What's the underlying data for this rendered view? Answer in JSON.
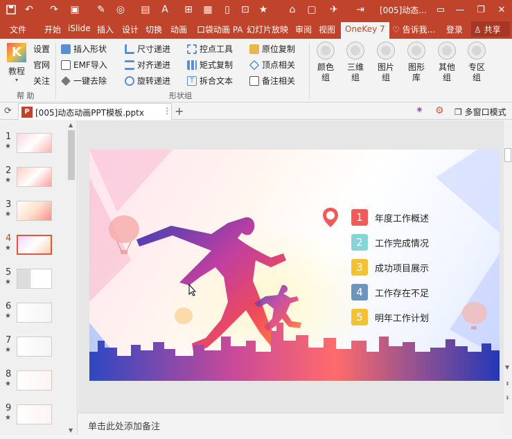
{
  "titlebar": {
    "doc_title": "[005]动态...",
    "icons": [
      "save-icon",
      "undo-icon",
      "redo-icon",
      "slideshow-icon",
      "format-painter-icon",
      "color-icon",
      "text-box-icon",
      "format-icon",
      "screenshot-icon",
      "image-icon",
      "document-icon",
      "star-icon",
      "bookmark-icon",
      "more-icon"
    ],
    "restore_glyph": "▭"
  },
  "tabs": {
    "file": "文件",
    "items": [
      "开始",
      "iSlide",
      "插入",
      "设计",
      "切换",
      "动画",
      "口袋动画 PA",
      "幻灯片放映",
      "审阅",
      "视图"
    ],
    "active": "OneKey 7",
    "tell_me": "告诉我...",
    "login": "登录",
    "share": "共享"
  },
  "ribbon": {
    "tutorial": "教程",
    "help_items": [
      "设置",
      "官网",
      "关注"
    ],
    "help_group": "帮 助",
    "shape_group": "形状组",
    "col1": [
      "插入形状",
      "EMF导入",
      "一键去除"
    ],
    "col2": [
      "尺寸递进",
      "对齐递进",
      "旋转递进"
    ],
    "col3": [
      "控点工具",
      "矩式复制",
      "拆合文本"
    ],
    "col4": [
      "原位复制",
      "顶点相关",
      "备注相关"
    ],
    "big_buttons": [
      {
        "l1": "颜色",
        "l2": "组"
      },
      {
        "l1": "三维",
        "l2": "组"
      },
      {
        "l1": "图片",
        "l2": "组"
      },
      {
        "l1": "图形",
        "l2": "库"
      },
      {
        "l1": "其他",
        "l2": "组"
      },
      {
        "l1": "专区",
        "l2": "组"
      }
    ]
  },
  "document": {
    "tab_name": "[005]动态动画PPT模板.pptx",
    "multi_window": "多窗口模式"
  },
  "thumbnails": {
    "numbers": [
      "1",
      "2",
      "3",
      "4",
      "5",
      "6",
      "7",
      "8",
      "9"
    ],
    "selected": "4",
    "star": "★"
  },
  "slide": {
    "toc": [
      {
        "num": "1",
        "text": "年度工作概述",
        "color": "#ef5b5b"
      },
      {
        "num": "2",
        "text": "工作完成情况",
        "color": "#86d3d8"
      },
      {
        "num": "3",
        "text": "成功项目展示",
        "color": "#f2c234"
      },
      {
        "num": "4",
        "text": "工作存在不足",
        "color": "#6b95bf"
      },
      {
        "num": "5",
        "text": "明年工作计划",
        "color": "#f2c234"
      }
    ]
  },
  "notes": {
    "placeholder": "单击此处添加备注"
  }
}
